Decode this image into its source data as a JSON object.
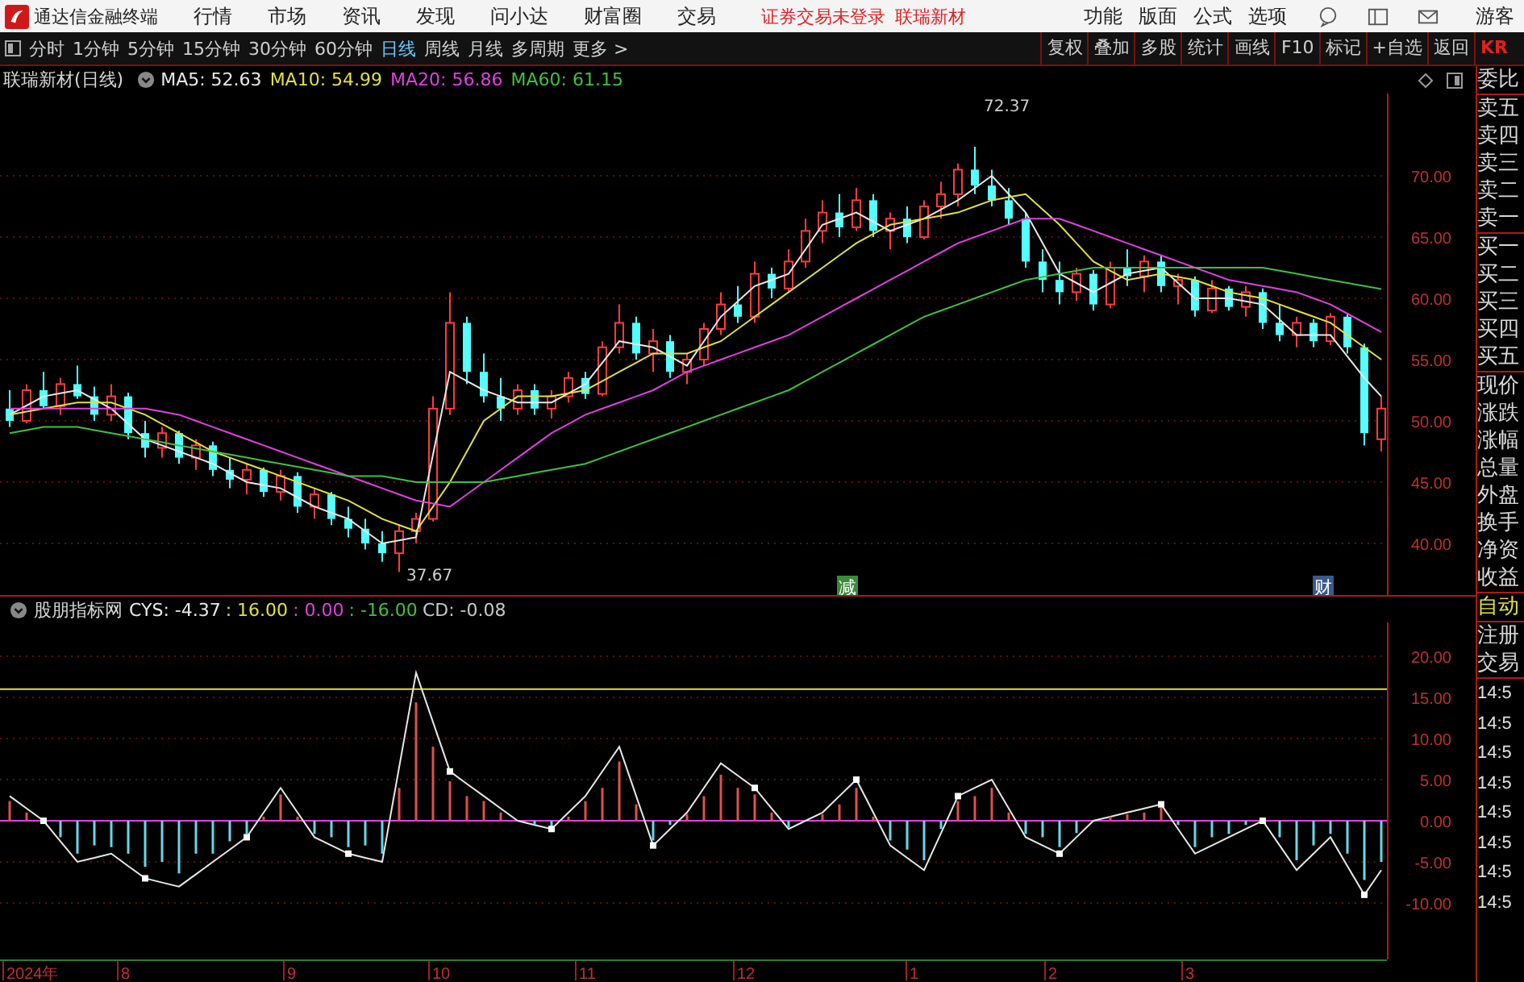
{
  "title_bar": {
    "app_name": "通达信金融终端",
    "menu": [
      "行情",
      "市场",
      "资讯",
      "发现",
      "问小达",
      "财富圈",
      "交易"
    ],
    "notice": "证券交易未登录",
    "stock_link": "联瑞新材",
    "right_menu": [
      "功能",
      "版面",
      "公式",
      "选项"
    ],
    "user": "游客"
  },
  "period_tabs": [
    {
      "label": "分时",
      "selected": false
    },
    {
      "label": "1分钟",
      "selected": false
    },
    {
      "label": "5分钟",
      "selected": false
    },
    {
      "label": "15分钟",
      "selected": false
    },
    {
      "label": "30分钟",
      "selected": false
    },
    {
      "label": "60分钟",
      "selected": false
    },
    {
      "label": "日线",
      "selected": true
    },
    {
      "label": "周线",
      "selected": false
    },
    {
      "label": "月线",
      "selected": false
    },
    {
      "label": "多周期",
      "selected": false
    },
    {
      "label": "更多 >",
      "selected": false
    }
  ],
  "tools": [
    "复权",
    "叠加",
    "多股",
    "统计",
    "画线",
    "F10",
    "标记",
    "+自选",
    "返回"
  ],
  "main_chart": {
    "title": "联瑞新材(日线)",
    "ma_values": [
      ": 52.63",
      ": 54.99",
      ": 56.86",
      ": 61.15"
    ],
    "chart_data": {
      "type": "candlestick",
      "grid": true,
      "ylim": [
        35.79,
        76.71
      ],
      "yticks": [
        {
          "value": 70,
          "label": "70.00"
        },
        {
          "value": 65,
          "label": "65.00"
        },
        {
          "value": 60,
          "label": "60.00"
        },
        {
          "value": 55,
          "label": "55.00"
        },
        {
          "value": 50,
          "label": "50.00"
        },
        {
          "value": 45,
          "label": "45.00"
        },
        {
          "value": 40,
          "label": "40.00"
        }
      ],
      "ohlc": [
        [
          51,
          52.5,
          49.5,
          50
        ],
        [
          50,
          53,
          49.8,
          52.5
        ],
        [
          52.5,
          54,
          51,
          51.2
        ],
        [
          51.2,
          53.5,
          50.5,
          53
        ],
        [
          53,
          54.5,
          51.8,
          52
        ],
        [
          52,
          52.8,
          50,
          50.5
        ],
        [
          50.5,
          53,
          50,
          52
        ],
        [
          52,
          52.3,
          48.5,
          49
        ],
        [
          49,
          50,
          47,
          47.8
        ],
        [
          47.8,
          49.5,
          47,
          49
        ],
        [
          49,
          49.2,
          46.5,
          47
        ],
        [
          47,
          48.5,
          46,
          48
        ],
        [
          48,
          48.3,
          45.5,
          46
        ],
        [
          46,
          47,
          44.5,
          45.2
        ],
        [
          45.2,
          46.5,
          44,
          46
        ],
        [
          46,
          46.2,
          43.8,
          44.2
        ],
        [
          44.2,
          46,
          43.5,
          45.5
        ],
        [
          45.5,
          45.8,
          42.5,
          43
        ],
        [
          43,
          44.5,
          42,
          44
        ],
        [
          44,
          44.2,
          41.5,
          42
        ],
        [
          42,
          43,
          40.5,
          41.2
        ],
        [
          41.2,
          42,
          39.5,
          40
        ],
        [
          40,
          41,
          38.5,
          39.2
        ],
        [
          39.2,
          41.5,
          37.67,
          41
        ],
        [
          41,
          42.5,
          40,
          42
        ],
        [
          42,
          52,
          41.8,
          51
        ],
        [
          51,
          60.5,
          50.5,
          58
        ],
        [
          58,
          58.5,
          53,
          54
        ],
        [
          54,
          55.5,
          51.5,
          52
        ],
        [
          52,
          53.5,
          50,
          51
        ],
        [
          51,
          53,
          50.5,
          52.5
        ],
        [
          52.5,
          53,
          50.5,
          51
        ],
        [
          51,
          52.5,
          50.2,
          52
        ],
        [
          52,
          54,
          51.5,
          53.5
        ],
        [
          53.5,
          54,
          51.8,
          52.2
        ],
        [
          52.2,
          56.5,
          52,
          56
        ],
        [
          56,
          59.5,
          55.5,
          58
        ],
        [
          58,
          58.5,
          55,
          55.5
        ],
        [
          55.5,
          57.5,
          54,
          56.5
        ],
        [
          56.5,
          57,
          53.5,
          54
        ],
        [
          54,
          55.5,
          53,
          55
        ],
        [
          55,
          58,
          54.5,
          57.5
        ],
        [
          57.5,
          60.5,
          57,
          59.5
        ],
        [
          59.5,
          61,
          58,
          58.5
        ],
        [
          58.5,
          63,
          58,
          62
        ],
        [
          62,
          62.5,
          60,
          60.8
        ],
        [
          60.8,
          64,
          60.5,
          63
        ],
        [
          63,
          66.5,
          62.5,
          65.5
        ],
        [
          65.5,
          68,
          64.5,
          67
        ],
        [
          67,
          68.5,
          65,
          65.8
        ],
        [
          65.8,
          69,
          65.5,
          68
        ],
        [
          68,
          68.5,
          65,
          65.5
        ],
        [
          65.5,
          67,
          64,
          66.5
        ],
        [
          66.5,
          67.5,
          64.5,
          65
        ],
        [
          65,
          68,
          64.8,
          67.5
        ],
        [
          67.5,
          69.5,
          66.5,
          68.5
        ],
        [
          68.5,
          71,
          67.5,
          70.5
        ],
        [
          70.5,
          72.37,
          68.5,
          69.2
        ],
        [
          69.2,
          70.5,
          67.5,
          68
        ],
        [
          68,
          69,
          66,
          66.5
        ],
        [
          66.5,
          67,
          62.5,
          63
        ],
        [
          63,
          64,
          60.5,
          61.5
        ],
        [
          61.5,
          63,
          59.5,
          60.5
        ],
        [
          60.5,
          62.5,
          59.8,
          62
        ],
        [
          62,
          62.3,
          59,
          59.5
        ],
        [
          59.5,
          63,
          59.2,
          62.5
        ],
        [
          62.5,
          64,
          61,
          61.8
        ],
        [
          61.8,
          63.5,
          60.5,
          63
        ],
        [
          63,
          63.5,
          60.5,
          61
        ],
        [
          61,
          62,
          59.5,
          61.5
        ],
        [
          61.5,
          61.8,
          58.5,
          59
        ],
        [
          59,
          61.5,
          58.8,
          60.8
        ],
        [
          60.8,
          61,
          59,
          59.3
        ],
        [
          59.3,
          61,
          58.5,
          60.5
        ],
        [
          60.5,
          60.8,
          57.5,
          58
        ],
        [
          58,
          59.5,
          56.5,
          57
        ],
        [
          57,
          58.5,
          56,
          58
        ],
        [
          58,
          58.3,
          56,
          56.5
        ],
        [
          56.5,
          58.8,
          56.2,
          58.5
        ],
        [
          58.5,
          58.8,
          55.5,
          56
        ],
        [
          56,
          56.3,
          48,
          49
        ],
        [
          48.5,
          52,
          47.5,
          51
        ]
      ],
      "series": [
        {
          "name": "MA5",
          "type": "line",
          "color": "#e8e8e8",
          "values": [
            50.5,
            51.25,
            52,
            52.25,
            52.5,
            51.75,
            51,
            49.75,
            48.5,
            48,
            47.5,
            47,
            46.5,
            45.75,
            45,
            44.75,
            44.5,
            43.75,
            43,
            42.5,
            42,
            41,
            40,
            40.25,
            40.5,
            47.25,
            54,
            53.25,
            52.5,
            52,
            51.5,
            51.5,
            51.5,
            52.25,
            53,
            54.75,
            56.5,
            56.25,
            56,
            55.25,
            54.5,
            56.5,
            58.5,
            59.75,
            61,
            61.5,
            62,
            64,
            66,
            66.5,
            67,
            66.25,
            65.5,
            66,
            66.5,
            67.25,
            68,
            69,
            70,
            68.5,
            67,
            64.5,
            62,
            61.25,
            60.5,
            61.25,
            62,
            62.25,
            62.5,
            61.25,
            60,
            60,
            60,
            59.75,
            59.5,
            58.25,
            57,
            57,
            57,
            55.25,
            53.5,
            52
          ]
        },
        {
          "name": "MA10",
          "type": "line",
          "color": "#e0e040",
          "values": [
            50.5,
            50.75,
            51,
            51.25,
            51.5,
            51.5,
            51.5,
            51,
            50.5,
            49.75,
            49,
            48.25,
            47.5,
            47,
            46.5,
            46,
            45.5,
            45,
            44.5,
            44,
            43.5,
            42.75,
            42,
            41.5,
            41,
            43,
            45,
            47.5,
            50,
            51,
            52,
            52,
            52,
            52.25,
            52.5,
            53.25,
            54,
            54.75,
            55.5,
            55.5,
            55.5,
            56,
            56.5,
            57.5,
            58.5,
            59.5,
            60.5,
            61.5,
            62.5,
            63.5,
            64.5,
            65.25,
            66,
            66.25,
            66.5,
            66.75,
            67,
            67.5,
            68,
            68.25,
            68.5,
            67.25,
            66,
            64.5,
            63,
            62.25,
            61.5,
            61.75,
            62,
            61.75,
            61.5,
            61,
            60.5,
            60.25,
            60,
            59.5,
            59,
            58.5,
            58,
            57,
            56,
            55
          ]
        },
        {
          "name": "MA20",
          "type": "line",
          "color": "#e040e0",
          "values": [
            51,
            51,
            51,
            51,
            51,
            51,
            51,
            51,
            51,
            50.75,
            50.5,
            50,
            49.5,
            49,
            48.5,
            48,
            47.5,
            47,
            46.5,
            46,
            45.5,
            45,
            44.5,
            44,
            43.5,
            43.25,
            43,
            44,
            45,
            46,
            47,
            48,
            49,
            49.75,
            50.5,
            51,
            51.5,
            52,
            52.5,
            53.25,
            54,
            54.5,
            55,
            55.5,
            56,
            56.5,
            57,
            57.75,
            58.5,
            59.25,
            60,
            60.75,
            61.5,
            62.25,
            63,
            63.75,
            64.5,
            65,
            65.5,
            66,
            66.5,
            66.5,
            66.5,
            66,
            65.5,
            65,
            64.5,
            64,
            63.5,
            63,
            62.5,
            62,
            61.5,
            61.25,
            61,
            60.75,
            60.5,
            60,
            59.5,
            58.75,
            58,
            57.25
          ]
        },
        {
          "name": "MA60",
          "type": "line",
          "color": "#40c040",
          "values": [
            49,
            49.25,
            49.5,
            49.5,
            49.5,
            49.25,
            49,
            48.75,
            48.5,
            48.25,
            48,
            47.75,
            47.5,
            47.25,
            47,
            46.75,
            46.5,
            46.25,
            46,
            45.75,
            45.5,
            45.5,
            45.5,
            45.25,
            45,
            45,
            45,
            45,
            45,
            45.25,
            45.5,
            45.75,
            46,
            46.25,
            46.5,
            47,
            47.5,
            48,
            48.5,
            49,
            49.5,
            50,
            50.5,
            51,
            51.5,
            52,
            52.5,
            53.25,
            54,
            54.75,
            55.5,
            56.25,
            57,
            57.75,
            58.5,
            59,
            59.5,
            60,
            60.5,
            61,
            61.5,
            61.75,
            62,
            62.25,
            62.5,
            62.5,
            62.5,
            62.5,
            62.5,
            62.5,
            62.5,
            62.5,
            62.5,
            62.5,
            62.5,
            62.25,
            62,
            61.75,
            61.5,
            61.25,
            61,
            60.75
          ]
        }
      ]
    },
    "high_label": "72.37",
    "low_label": "37.67",
    "markers": [
      {
        "text": "减",
        "color": "#3a8a3a"
      },
      {
        "text": "财",
        "color": "#3a5a8a"
      }
    ]
  },
  "indicator": {
    "name": "股朋指标网",
    "line_value": ": -4.37",
    "values": [
      {
        "label": ": 16.00",
        "color": "#e0e040"
      },
      {
        "label": ": 0.00",
        "color": "#e040e0"
      },
      {
        "label": ": -16.00",
        "color": "#40c040"
      }
    ],
    "bar_value": ": -0.08",
    "chart_data": {
      "type": "line",
      "grid": true,
      "ylim": [
        -16.86,
        24.12
      ],
      "yticks": [
        {
          "value": 20,
          "label": "20.00"
        },
        {
          "value": 15,
          "label": "15.00"
        },
        {
          "value": 10,
          "label": "10.00"
        },
        {
          "value": 5,
          "label": "5.00"
        },
        {
          "value": 0,
          "label": "0.00"
        },
        {
          "value": -5,
          "label": "-5.00"
        },
        {
          "value": -10,
          "label": "-10.00"
        }
      ],
      "ref_lines": [
        {
          "axis": "y",
          "value": 16,
          "color": "#e0e040"
        },
        {
          "axis": "y",
          "value": 0,
          "color": "#e040e0"
        }
      ],
      "series": [
        {
          "name": "CYS",
          "type": "line",
          "color": "#e8e8e8",
          "values": [
            3,
            1.5,
            0,
            -2.5,
            -5,
            -4.5,
            -4,
            -5.5,
            -7,
            -7.5,
            -8,
            -6.5,
            -5,
            -3.5,
            -2,
            1,
            4,
            1,
            -2,
            -3,
            -4,
            -4.5,
            -5,
            6.5,
            18,
            12,
            6,
            4.5,
            3,
            1.5,
            0,
            -0.5,
            -1,
            1,
            3,
            6,
            9,
            3,
            -3,
            -1,
            1,
            4,
            7,
            5.5,
            4,
            1.5,
            -1,
            0,
            1,
            3,
            5,
            1,
            -3,
            -4.5,
            -6,
            -1.5,
            3,
            4,
            5,
            1.5,
            -2,
            -3,
            -4,
            -2,
            0,
            0.5,
            1,
            1.5,
            2,
            -1,
            -4,
            -3,
            -2,
            -1,
            0,
            -3,
            -6,
            -4,
            -2,
            -5.5,
            -9,
            -6
          ]
        },
        {
          "name": "CD",
          "type": "bar",
          "color": "#e05050",
          "values": [
            2.4,
            1,
            null,
            null,
            null,
            null,
            null,
            null,
            null,
            null,
            null,
            null,
            null,
            null,
            null,
            0.5,
            3.2,
            0.5,
            null,
            null,
            null,
            null,
            null,
            4,
            14.4,
            9,
            4.8,
            3,
            2.4,
            1,
            null,
            null,
            null,
            0.5,
            2.4,
            4,
            7.2,
            2,
            null,
            null,
            0.8,
            3,
            5.6,
            4,
            3.2,
            1,
            null,
            null,
            0.8,
            2,
            4,
            0.5,
            null,
            null,
            null,
            null,
            2.4,
            3,
            4,
            1,
            null,
            null,
            null,
            null,
            null,
            0.5,
            0.8,
            1,
            1.6,
            null,
            null,
            null,
            null,
            null,
            null,
            null,
            null,
            null,
            null,
            null,
            null,
            null
          ]
        },
        {
          "type": "bar",
          "color": "#66d8e8",
          "values": [
            null,
            null,
            null,
            -2,
            -4,
            -3,
            -3.2,
            -4,
            -5.6,
            -5,
            -6.4,
            -4,
            -4,
            -2.5,
            -1.6,
            null,
            null,
            null,
            -1.6,
            -2,
            -3.2,
            -3,
            -4,
            null,
            null,
            null,
            null,
            null,
            null,
            null,
            null,
            -0.5,
            -0.8,
            null,
            null,
            null,
            null,
            null,
            -2.4,
            -0.5,
            null,
            null,
            null,
            null,
            null,
            null,
            -0.8,
            null,
            null,
            null,
            null,
            null,
            -2.4,
            -3.5,
            -4.8,
            -1,
            null,
            null,
            null,
            null,
            -1.6,
            -2,
            -3.2,
            -1.5,
            null,
            null,
            null,
            null,
            null,
            -0.5,
            -3.2,
            -2,
            -1.6,
            -0.5,
            null,
            -2,
            -4.8,
            -3,
            -1.6,
            -4,
            -7.2,
            -5
          ]
        },
        {
          "type": "scatter",
          "color": "#ffffff",
          "values": [
            null,
            null,
            0,
            null,
            null,
            null,
            null,
            null,
            -7,
            null,
            null,
            null,
            null,
            null,
            -2,
            null,
            null,
            null,
            null,
            null,
            -4,
            null,
            null,
            null,
            null,
            null,
            6,
            null,
            null,
            null,
            null,
            null,
            -1,
            null,
            null,
            null,
            null,
            null,
            -3,
            null,
            null,
            null,
            null,
            null,
            4,
            null,
            null,
            null,
            null,
            null,
            5,
            null,
            null,
            null,
            null,
            null,
            3,
            null,
            null,
            null,
            null,
            null,
            -4,
            null,
            null,
            null,
            null,
            null,
            2,
            null,
            null,
            null,
            null,
            null,
            0,
            null,
            null,
            null,
            null,
            null,
            -9,
            null
          ]
        }
      ]
    }
  },
  "x_axis": [
    "2024年",
    "8",
    "9",
    "10",
    "11",
    "12",
    "1",
    "2",
    "3"
  ],
  "quote_panel": {
    "corner": "KR",
    "groups": [
      [
        "委比"
      ],
      [
        "卖五",
        "卖四",
        "卖三",
        "卖二",
        "卖一"
      ],
      [
        "买一",
        "买二",
        "买三",
        "买四",
        "买五"
      ],
      [
        "现价",
        "涨跌",
        "涨幅",
        "总量",
        "外盘",
        "换手",
        "净资",
        "收益"
      ]
    ],
    "mode": "自动",
    "actions": [
      "注册",
      "交易"
    ],
    "times": [
      "14:5",
      "14:5",
      "14:5",
      "14:5",
      "14:5",
      "14:5",
      "14:5",
      "14:5"
    ]
  }
}
